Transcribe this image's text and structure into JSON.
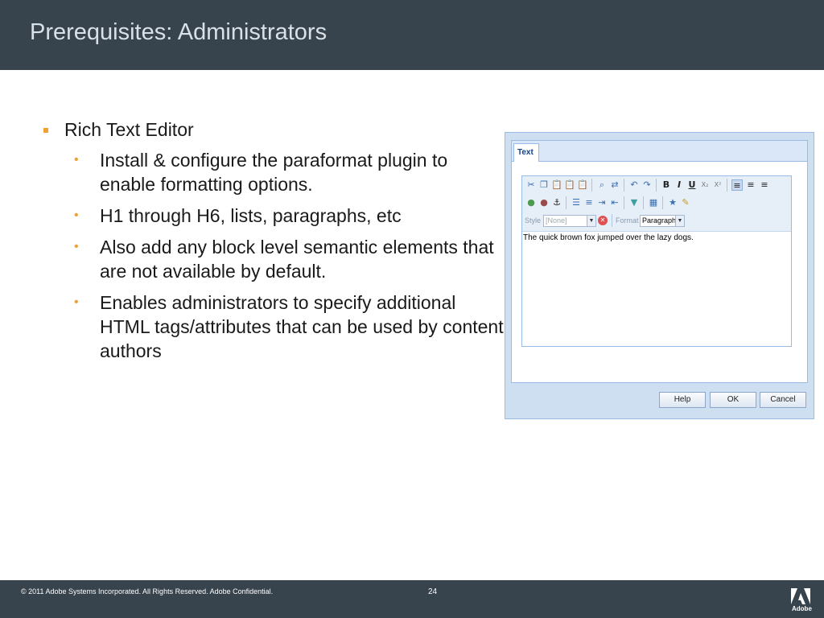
{
  "slide": {
    "title": "Prerequisites: Administrators",
    "bullets": {
      "main": "Rich Text Editor",
      "sub": [
        "Install & configure the paraformat plugin to enable formatting options.",
        "H1 through H6, lists, paragraphs, etc",
        "Also add any block level semantic elements that are not available by default.",
        "Enables administrators to specify additional HTML tags/attributes that can be used by content authors"
      ]
    }
  },
  "dialog": {
    "tab_label": "Text",
    "style_label": "Style",
    "style_value": "[None]",
    "format_label": "Format",
    "format_value": "Paragraph",
    "editor_text": "The quick brown fox jumped over the lazy dogs.",
    "buttons": {
      "help": "Help",
      "ok": "OK",
      "cancel": "Cancel"
    },
    "toolbar_glyphs": {
      "bold": "B",
      "italic": "I",
      "underline": "U",
      "subscript": "X₂",
      "superscript": "X²",
      "anchor": "⚓",
      "bullets": "☰",
      "numbers": "≡",
      "table": "▦",
      "star": "★",
      "close": "✕"
    }
  },
  "footer": {
    "copyright": "© 2011 Adobe Systems Incorporated.  All Rights Reserved.  Adobe Confidential.",
    "page_number": "24",
    "logo_text": "Adobe"
  },
  "colors": {
    "header_bg": "#37434d",
    "bullet_accent": "#f0a030",
    "dialog_bg": "#cfdff2"
  }
}
